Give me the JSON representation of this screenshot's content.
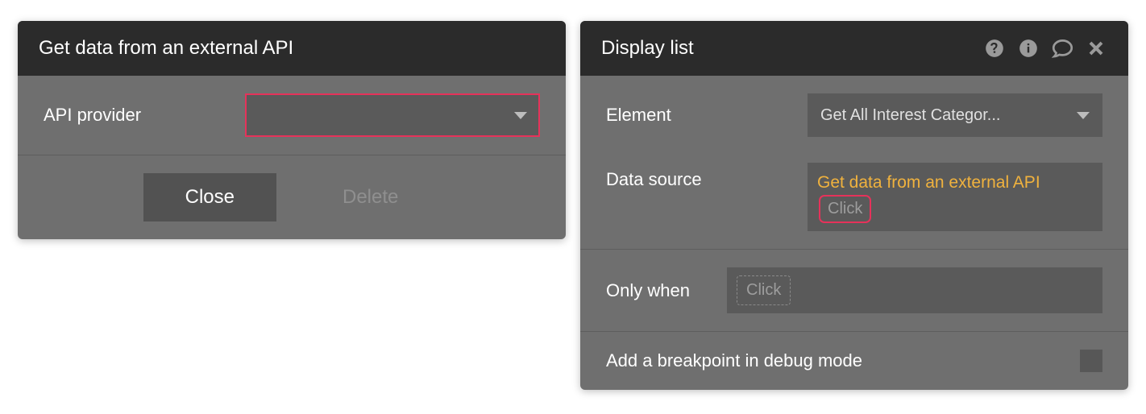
{
  "left_panel": {
    "title": "Get data from an external API",
    "rows": {
      "api_provider": {
        "label": "API provider",
        "value": ""
      }
    },
    "buttons": {
      "close": "Close",
      "delete": "Delete"
    }
  },
  "right_panel": {
    "title": "Display list",
    "rows": {
      "element": {
        "label": "Element",
        "value": "Get All Interest Categor..."
      },
      "data_source": {
        "label": "Data source",
        "expression": "Get data from an external API",
        "click_label": "Click"
      },
      "only_when": {
        "label": "Only when",
        "click_label": "Click"
      },
      "breakpoint": {
        "label": "Add a breakpoint in debug mode",
        "checked": false
      }
    }
  }
}
